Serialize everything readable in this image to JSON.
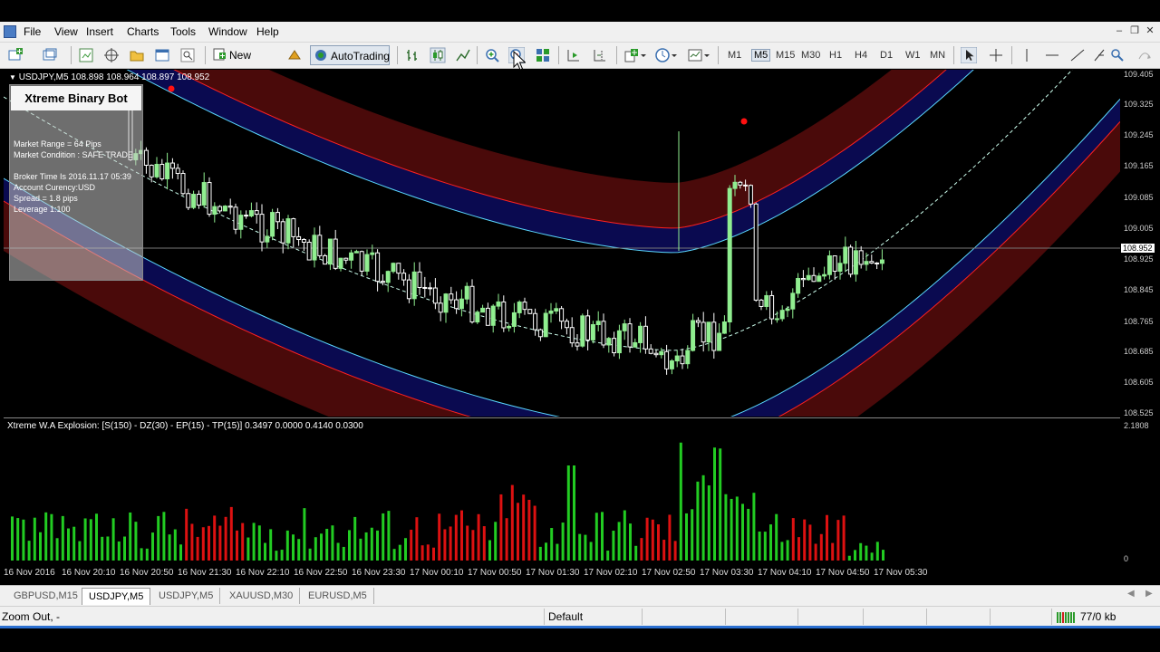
{
  "menu": [
    "File",
    "View",
    "Insert",
    "Charts",
    "Tools",
    "Window",
    "Help"
  ],
  "toolbar": {
    "new_order": "New Order",
    "autotrading": "AutoTrading",
    "timeframes": [
      "M1",
      "M5",
      "M15",
      "M30",
      "H1",
      "H4",
      "D1",
      "W1",
      "MN"
    ],
    "active_timeframe": "M5"
  },
  "chart": {
    "header": "USDJPY,M5  108.898 108.964 108.897 108.952",
    "current_price": "108.952",
    "price_levels": [
      "109.405",
      "109.325",
      "109.245",
      "109.165",
      "109.085",
      "109.005",
      "108.925",
      "108.845",
      "108.765",
      "108.685",
      "108.605",
      "108.525"
    ],
    "info_panel": {
      "title": "Xtreme Binary Bot",
      "lines": [
        "Market Range = 64 Pips",
        "Market Condition : SAFE TRADE",
        "Broker Time Is 2016.11.17 05:39",
        "Account Curency:USD",
        "Spread = 1.8 pips",
        "Leverage 1:100"
      ]
    }
  },
  "indicator": {
    "header": "Xtreme W.A Explosion: [S(150) - DZ(30) - EP(15) - TP(15)] 0.3497 0.0000 0.4140 0.0300",
    "max_label": "2.1808",
    "zero_label": "0"
  },
  "time_axis": [
    "16 Nov 2016",
    "16 Nov 20:10",
    "16 Nov 20:50",
    "16 Nov 21:30",
    "16 Nov 22:10",
    "16 Nov 22:50",
    "16 Nov 23:30",
    "17 Nov 00:10",
    "17 Nov 00:50",
    "17 Nov 01:30",
    "17 Nov 02:10",
    "17 Nov 02:50",
    "17 Nov 03:30",
    "17 Nov 04:10",
    "17 Nov 04:50",
    "17 Nov 05:30"
  ],
  "tabs": [
    "GBPUSD,M15",
    "USDJPY,M5",
    "USDJPY,M5",
    "XAUUSD,M30",
    "EURUSD,M5"
  ],
  "active_tab_index": 1,
  "status": {
    "left": "Zoom Out, -",
    "profile": "Default",
    "traffic": "77/0 kb"
  },
  "colors": {
    "bull_candle": "#90ee90",
    "bear_candle": "#ffffff",
    "hist_up": "#22cc22",
    "hist_down": "#dd1111",
    "band_fill": "#4a0a0a",
    "band_inner": "#0a0a50",
    "band_red_line": "#ff2020",
    "band_cyan_line": "#5ad8ff"
  }
}
